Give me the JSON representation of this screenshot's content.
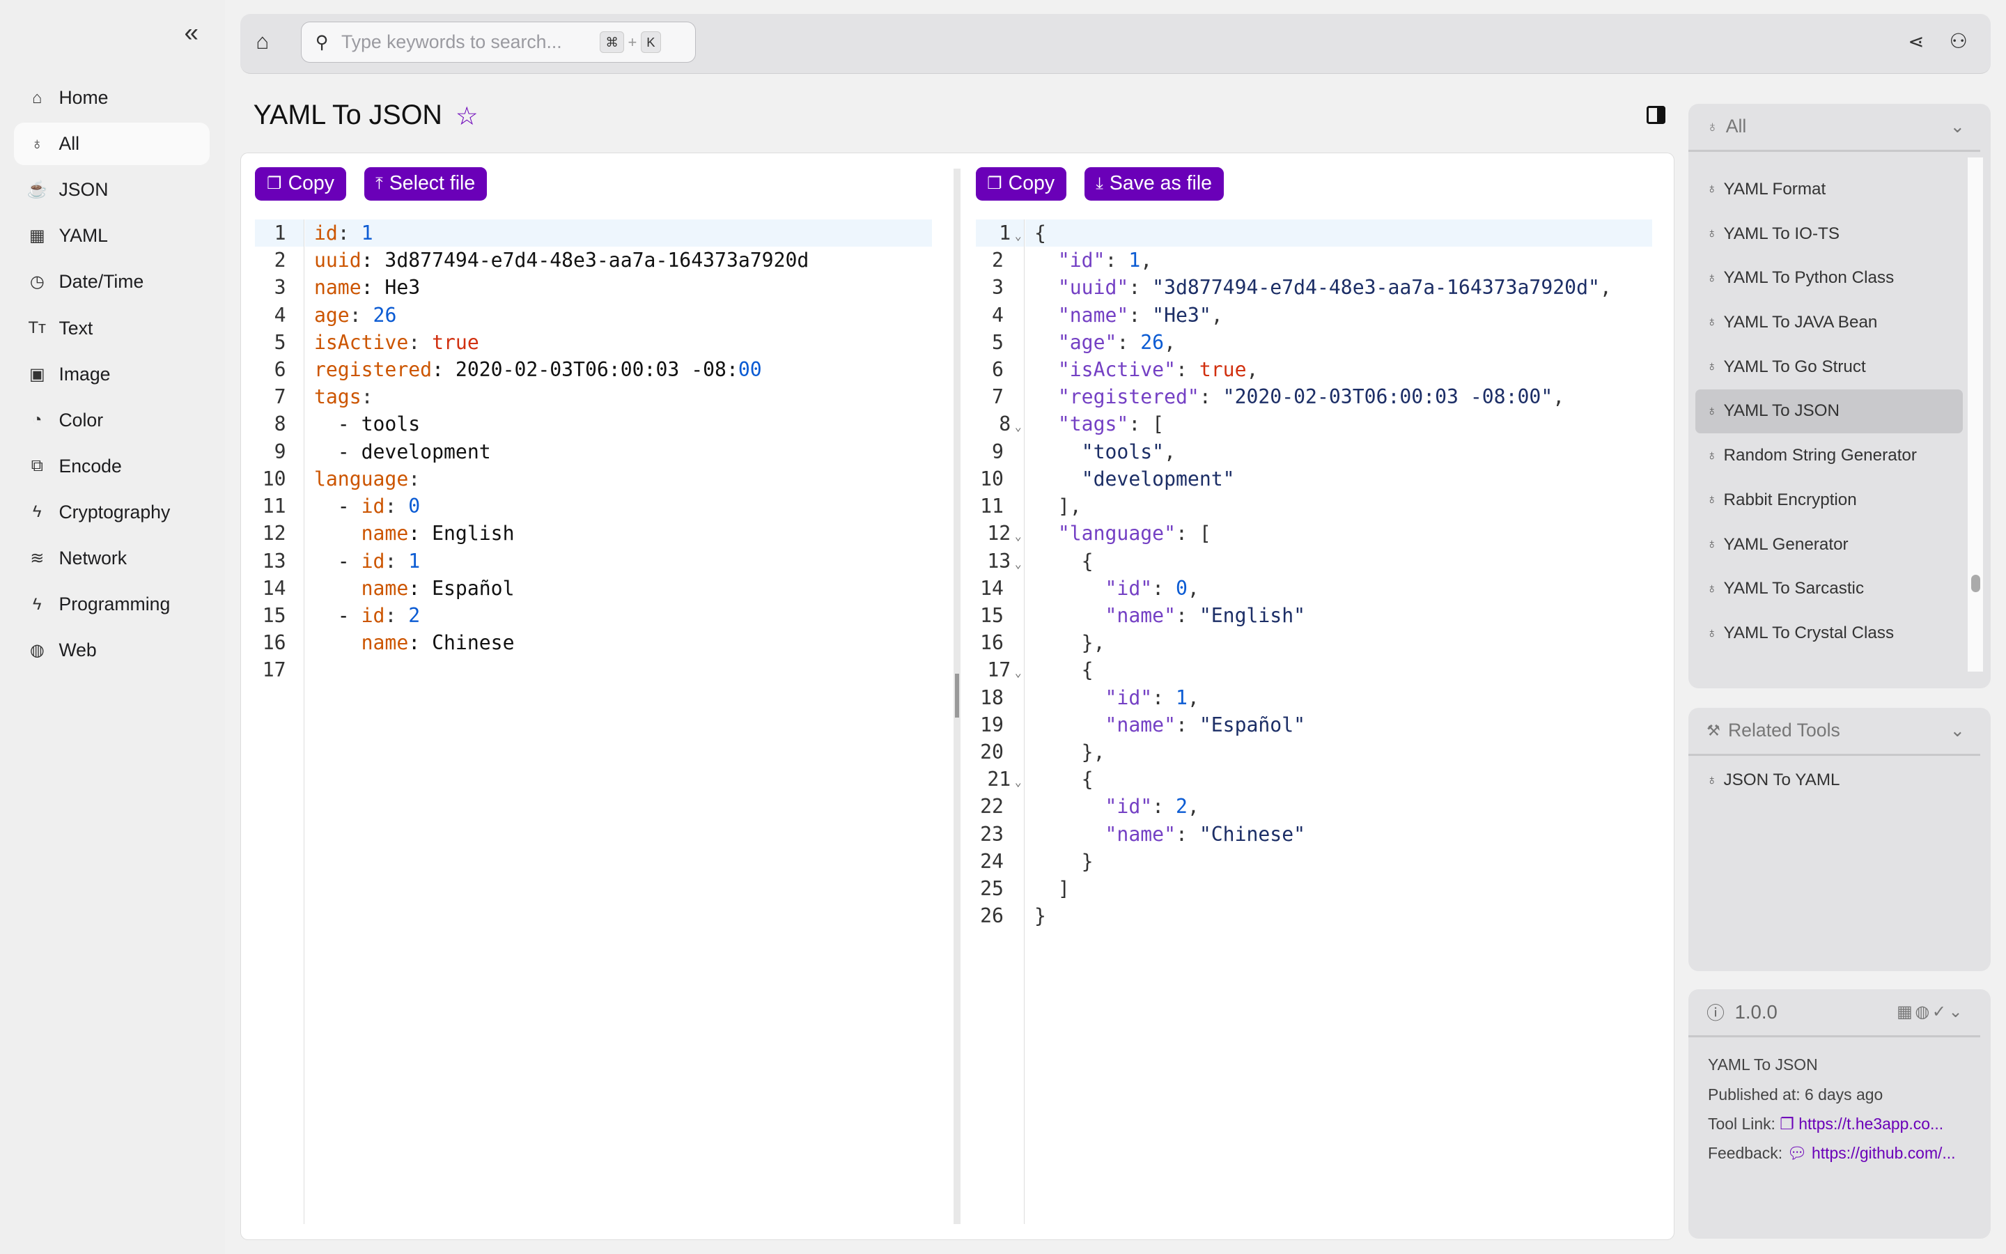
{
  "sidebar": {
    "items": [
      {
        "label": "Home",
        "icon": "home-icon",
        "glyph": "⌂"
      },
      {
        "label": "All",
        "icon": "rocket-icon",
        "glyph": "♁",
        "active": true
      },
      {
        "label": "JSON",
        "icon": "coffee-icon",
        "glyph": "☕"
      },
      {
        "label": "YAML",
        "icon": "grid-icon",
        "glyph": "▦"
      },
      {
        "label": "Date/Time",
        "icon": "clock-icon",
        "glyph": "◷"
      },
      {
        "label": "Text",
        "icon": "text-icon",
        "glyph": "Tт"
      },
      {
        "label": "Image",
        "icon": "image-icon",
        "glyph": "▣"
      },
      {
        "label": "Color",
        "icon": "palette-icon",
        "glyph": "◔"
      },
      {
        "label": "Encode",
        "icon": "encode-icon",
        "glyph": "⧉"
      },
      {
        "label": "Cryptography",
        "icon": "bolt-icon",
        "glyph": "ϟ"
      },
      {
        "label": "Network",
        "icon": "wifi-icon",
        "glyph": "≋"
      },
      {
        "label": "Programming",
        "icon": "bolt-icon",
        "glyph": "ϟ"
      },
      {
        "label": "Web",
        "icon": "globe-icon",
        "glyph": "◍"
      }
    ]
  },
  "search": {
    "placeholder": "Type keywords to search...",
    "shortcut_mod": "⌘",
    "shortcut_plus": "+",
    "shortcut_key": "K"
  },
  "page": {
    "title": "YAML To JSON"
  },
  "left": {
    "copy_label": "Copy",
    "select_label": "Select file",
    "lines": [
      [
        [
          "id",
          "key"
        ],
        [
          ": ",
          "punc"
        ],
        [
          "1",
          "num"
        ]
      ],
      [
        [
          "uuid",
          "key"
        ],
        [
          ": 3d877494-e7d4-48e3-aa7a-164373a7920d",
          "str"
        ]
      ],
      [
        [
          "name",
          "key"
        ],
        [
          ": He3",
          "str"
        ]
      ],
      [
        [
          "age",
          "key"
        ],
        [
          ": ",
          "punc"
        ],
        [
          "26",
          "num"
        ]
      ],
      [
        [
          "isActive",
          "key"
        ],
        [
          ": ",
          "punc"
        ],
        [
          "true",
          "bool"
        ]
      ],
      [
        [
          "registered",
          "key"
        ],
        [
          ": 2020-02-03T06:00:03 -08:",
          "str"
        ],
        [
          "00",
          "num"
        ]
      ],
      [
        [
          "tags",
          "key"
        ],
        [
          ":",
          "punc"
        ]
      ],
      [
        [
          "  - tools",
          "str"
        ]
      ],
      [
        [
          "  - development",
          "str"
        ]
      ],
      [
        [
          "language",
          "key"
        ],
        [
          ":",
          "punc"
        ]
      ],
      [
        [
          "  - ",
          "str"
        ],
        [
          "id",
          "key"
        ],
        [
          ": ",
          "punc"
        ],
        [
          "0",
          "num"
        ]
      ],
      [
        [
          "    ",
          "str"
        ],
        [
          "name",
          "key"
        ],
        [
          ": English",
          "str"
        ]
      ],
      [
        [
          "  - ",
          "str"
        ],
        [
          "id",
          "key"
        ],
        [
          ": ",
          "punc"
        ],
        [
          "1",
          "num"
        ]
      ],
      [
        [
          "    ",
          "str"
        ],
        [
          "name",
          "key"
        ],
        [
          ": Español",
          "str"
        ]
      ],
      [
        [
          "  - ",
          "str"
        ],
        [
          "id",
          "key"
        ],
        [
          ": ",
          "punc"
        ],
        [
          "2",
          "num"
        ]
      ],
      [
        [
          "    ",
          "str"
        ],
        [
          "name",
          "key"
        ],
        [
          ": Chinese",
          "str"
        ]
      ],
      []
    ]
  },
  "right": {
    "copy_label": "Copy",
    "save_label": "Save as file",
    "folds": [
      1,
      8,
      12,
      13,
      17,
      21
    ],
    "lines": [
      [
        [
          "{",
          "punc"
        ]
      ],
      [
        [
          "  ",
          "punc"
        ],
        [
          "\"id\"",
          "jkey"
        ],
        [
          ": ",
          "punc"
        ],
        [
          "1",
          "num"
        ],
        [
          ",",
          "punc"
        ]
      ],
      [
        [
          "  ",
          "punc"
        ],
        [
          "\"uuid\"",
          "jkey"
        ],
        [
          ": ",
          "punc"
        ],
        [
          "\"3d877494-e7d4-48e3-aa7a-164373a7920d\"",
          "jstr"
        ],
        [
          ",",
          "punc"
        ]
      ],
      [
        [
          "  ",
          "punc"
        ],
        [
          "\"name\"",
          "jkey"
        ],
        [
          ": ",
          "punc"
        ],
        [
          "\"He3\"",
          "jstr"
        ],
        [
          ",",
          "punc"
        ]
      ],
      [
        [
          "  ",
          "punc"
        ],
        [
          "\"age\"",
          "jkey"
        ],
        [
          ": ",
          "punc"
        ],
        [
          "26",
          "num"
        ],
        [
          ",",
          "punc"
        ]
      ],
      [
        [
          "  ",
          "punc"
        ],
        [
          "\"isActive\"",
          "jkey"
        ],
        [
          ": ",
          "punc"
        ],
        [
          "true",
          "bool"
        ],
        [
          ",",
          "punc"
        ]
      ],
      [
        [
          "  ",
          "punc"
        ],
        [
          "\"registered\"",
          "jkey"
        ],
        [
          ": ",
          "punc"
        ],
        [
          "\"2020-02-03T06:00:03 -08:00\"",
          "jstr"
        ],
        [
          ",",
          "punc"
        ]
      ],
      [
        [
          "  ",
          "punc"
        ],
        [
          "\"tags\"",
          "jkey"
        ],
        [
          ": [",
          "punc"
        ]
      ],
      [
        [
          "    ",
          "punc"
        ],
        [
          "\"tools\"",
          "jstr"
        ],
        [
          ",",
          "punc"
        ]
      ],
      [
        [
          "    ",
          "punc"
        ],
        [
          "\"development\"",
          "jstr"
        ]
      ],
      [
        [
          "  ],",
          "punc"
        ]
      ],
      [
        [
          "  ",
          "punc"
        ],
        [
          "\"language\"",
          "jkey"
        ],
        [
          ": [",
          "punc"
        ]
      ],
      [
        [
          "    {",
          "punc"
        ]
      ],
      [
        [
          "      ",
          "punc"
        ],
        [
          "\"id\"",
          "jkey"
        ],
        [
          ": ",
          "punc"
        ],
        [
          "0",
          "num"
        ],
        [
          ",",
          "punc"
        ]
      ],
      [
        [
          "      ",
          "punc"
        ],
        [
          "\"name\"",
          "jkey"
        ],
        [
          ": ",
          "punc"
        ],
        [
          "\"English\"",
          "jstr"
        ]
      ],
      [
        [
          "    },",
          "punc"
        ]
      ],
      [
        [
          "    {",
          "punc"
        ]
      ],
      [
        [
          "      ",
          "punc"
        ],
        [
          "\"id\"",
          "jkey"
        ],
        [
          ": ",
          "punc"
        ],
        [
          "1",
          "num"
        ],
        [
          ",",
          "punc"
        ]
      ],
      [
        [
          "      ",
          "punc"
        ],
        [
          "\"name\"",
          "jkey"
        ],
        [
          ": ",
          "punc"
        ],
        [
          "\"Español\"",
          "jstr"
        ]
      ],
      [
        [
          "    },",
          "punc"
        ]
      ],
      [
        [
          "    {",
          "punc"
        ]
      ],
      [
        [
          "      ",
          "punc"
        ],
        [
          "\"id\"",
          "jkey"
        ],
        [
          ": ",
          "punc"
        ],
        [
          "2",
          "num"
        ],
        [
          ",",
          "punc"
        ]
      ],
      [
        [
          "      ",
          "punc"
        ],
        [
          "\"name\"",
          "jkey"
        ],
        [
          ": ",
          "punc"
        ],
        [
          "\"Chinese\"",
          "jstr"
        ]
      ],
      [
        [
          "    }",
          "punc"
        ]
      ],
      [
        [
          "  ]",
          "punc"
        ]
      ],
      [
        [
          "}",
          "punc"
        ]
      ]
    ]
  },
  "tools_panel": {
    "header": "All",
    "items": [
      "YAML Format",
      "YAML To IO-TS",
      "YAML To Python Class",
      "YAML To JAVA Bean",
      "YAML To Go Struct",
      "YAML To JSON",
      "Random String Generator",
      "Rabbit Encryption",
      "YAML Generator",
      "YAML To Sarcastic",
      "YAML To Crystal Class"
    ],
    "active": "YAML To JSON"
  },
  "related": {
    "header": "Related Tools",
    "items": [
      "JSON To YAML"
    ]
  },
  "info": {
    "version": "1.0.0",
    "name": "YAML To JSON",
    "published_label": "Published at:",
    "published": "6 days ago",
    "tool_link_label": "Tool Link:",
    "tool_link": "https://t.he3app.co...",
    "feedback_label": "Feedback:",
    "feedback": "https://github.com/..."
  },
  "colors": {
    "accent": "#6a00b8"
  }
}
